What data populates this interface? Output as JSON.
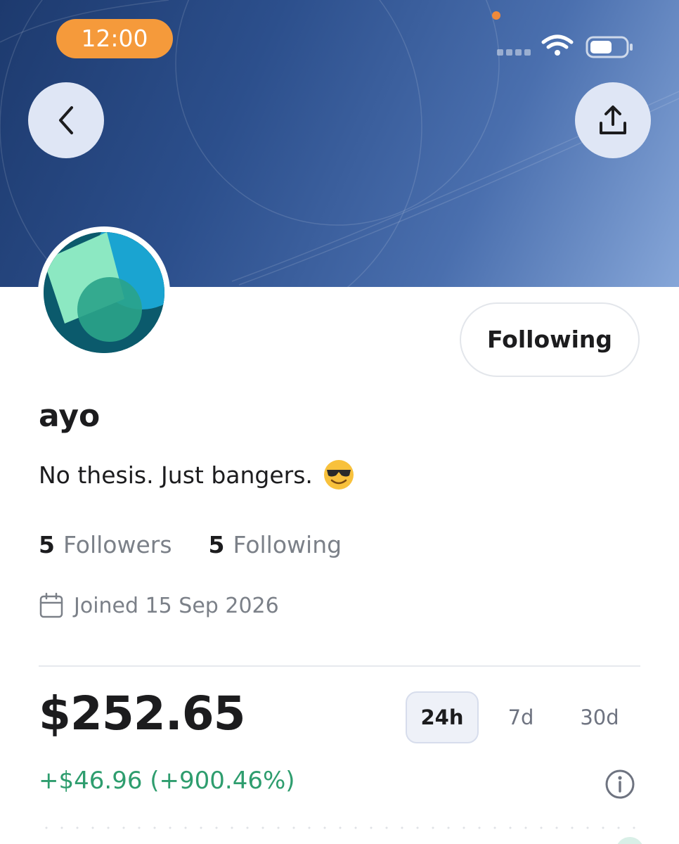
{
  "status_bar": {
    "time": "12:00"
  },
  "header": {
    "back_icon": "chevron-left-icon",
    "share_icon": "share-upload-icon"
  },
  "profile": {
    "username": "ayo",
    "bio": "No thesis. Just bangers.",
    "bio_emoji": "smiling-face-with-sunglasses",
    "follow_button_label": "Following",
    "followers_count": "5",
    "followers_label": "Followers",
    "following_count": "5",
    "following_label": "Following",
    "joined_text": "Joined 15 Sep 2026"
  },
  "portfolio": {
    "balance": "$252.65",
    "change": "+$46.96 (+900.46%)",
    "periods": [
      "24h",
      "7d",
      "30d"
    ],
    "selected_period": "24h"
  },
  "colors": {
    "accent_orange": "#f59a3b",
    "positive_green": "#2e9d6e",
    "banner_dark": "#1d3a6e",
    "banner_light": "#86a6d8"
  }
}
